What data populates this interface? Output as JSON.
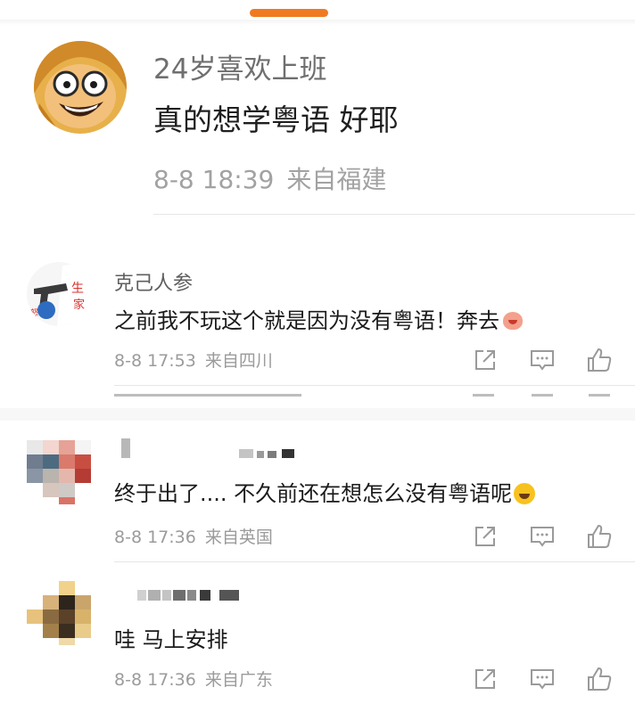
{
  "main_post": {
    "username": "24岁喜欢上班",
    "text": "真的想学粤语 好耶",
    "date": "8-8 18:39",
    "location": "来自福建",
    "avatar_icon": "cartoon-face-avatar"
  },
  "comments": [
    {
      "username": "克己人参",
      "text": "之前我不玩这个就是因为没有粤语！奔去",
      "emoji": "pink-creature-emoji",
      "date": "8-8 17:53",
      "location": "来自四川",
      "avatar_icon": "gun-sticker-avatar"
    },
    {
      "username": "",
      "text": "终于出了.... 不久前还在想怎么没有粤语呢",
      "emoji": "laughing-tears-emoji",
      "date": "8-8 17:36",
      "location": "来自英国",
      "avatar_icon": "pixelated-avatar"
    },
    {
      "username": "",
      "text": "哇 马上安排",
      "date": "8-8 17:36",
      "location": "来自广东",
      "avatar_icon": "pixelated-avatar"
    }
  ],
  "actions": {
    "share_icon": "share-icon",
    "comment_icon": "comment-icon",
    "like_icon": "thumbs-up-icon"
  },
  "colors": {
    "accent": "#f07a22",
    "meta": "#9b9b9b",
    "text": "#1a1a1a"
  }
}
